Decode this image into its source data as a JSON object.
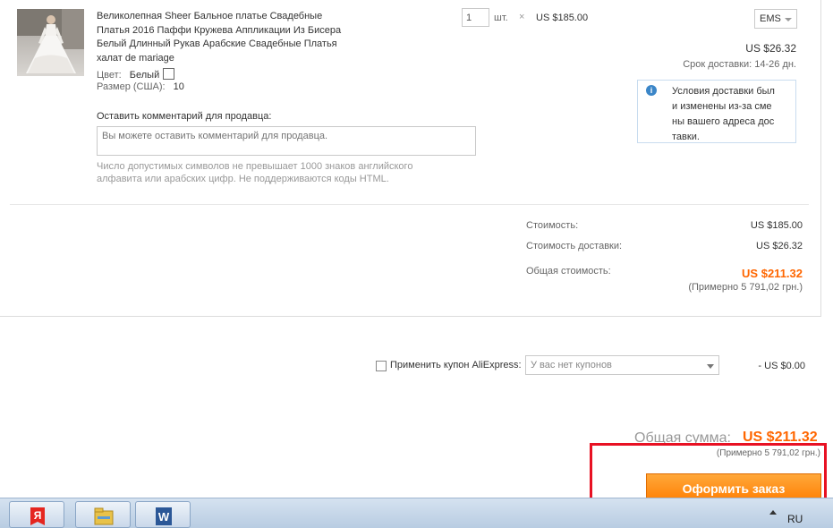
{
  "product": {
    "title": "Великолепная Sheer Бальное платье Свадебные Платья 2016 Паффи Кружева Аппликации Из Бисера Белый Длинный Рукав Арабские Свадебные Платья халат de mariage",
    "color_label": "Цвет:",
    "color_value": "Белый",
    "size_label": "Размер (США):",
    "size_value": "10",
    "quantity": "1",
    "unit": "шт.",
    "times": "×",
    "price": "US $185.00"
  },
  "shipping": {
    "method": "EMS",
    "cost": "US $26.32",
    "delivery": "Срок доставки: 14-26 дн.",
    "notice_icon": "info-icon",
    "notice": "Условия доставки были изменены из-за смены вашего адреса доставки."
  },
  "comment": {
    "label": "Оставить комментарий для продавца:",
    "placeholder": "Вы можете оставить комментарий для продавца.",
    "help": "Число допустимых символов не превышает 1000 знаков английского алфавита или арабских цифр. Не поддерживаются коды HTML."
  },
  "summary": {
    "cost_label": "Стоимость:",
    "cost_value": "US $185.00",
    "shipping_label": "Стоимость доставки:",
    "shipping_value": "US $26.32",
    "total_label": "Общая стоимость:",
    "total_value": "US $211.32",
    "approx": "(Примерно 5 791,02 грн.)"
  },
  "coupon": {
    "label": "Применить купон AliExpress:",
    "select_value": "У вас нет купонов",
    "discount": "- US $0.00"
  },
  "grand_total": {
    "label": "Общая сумма:",
    "value": "US $211.32",
    "approx": "(Примерно 5 791,02 грн.)"
  },
  "order_button": "Оформить заказ",
  "taskbar": {
    "apps": [
      "yandex-browser-icon",
      "file-explorer-icon",
      "word-icon"
    ],
    "language": "RU"
  },
  "colors": {
    "accent": "#ff6600",
    "button": "#ff7d00",
    "highlight": "#e81123",
    "info": "#3b86c8"
  }
}
